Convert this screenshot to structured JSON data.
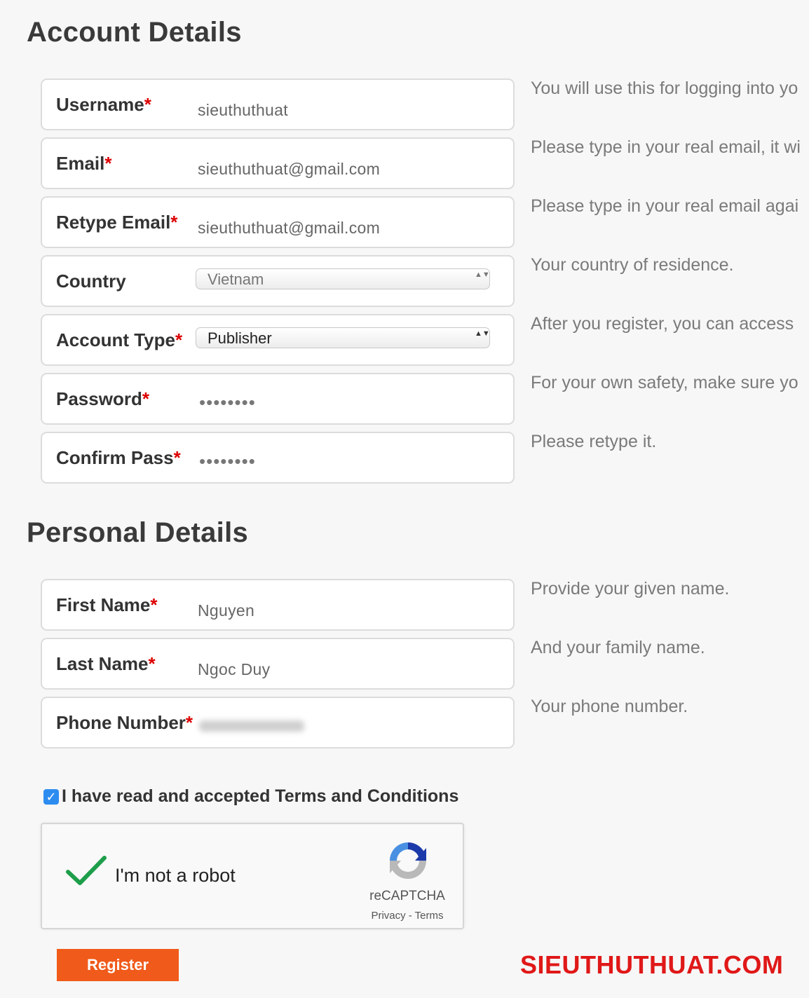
{
  "sections": {
    "account_title": "Account Details",
    "personal_title": "Personal Details"
  },
  "account_fields": [
    {
      "label": "Username",
      "required": "*",
      "value": "sieuthuthuat",
      "hint": "You will use this for logging into yo"
    },
    {
      "label": "Email",
      "required": "*",
      "value": "sieuthuthuat@gmail.com",
      "hint": "Please type in your real email, it wi"
    },
    {
      "label": "Retype Email",
      "required": "*",
      "value": "sieuthuthuat@gmail.com",
      "hint": "Please type in your real email agai"
    },
    {
      "label": "Country",
      "required": "",
      "value": "Vietnam",
      "hint": "Your country of residence."
    },
    {
      "label": "Account Type",
      "required": "*",
      "value": "Publisher",
      "hint": "After you register, you can access"
    },
    {
      "label": "Password",
      "required": "*",
      "value": "••••••••",
      "hint": "For your own safety, make sure yo"
    },
    {
      "label": "Confirm Pass",
      "required": "*",
      "value": "••••••••",
      "hint": "Please retype it."
    }
  ],
  "personal_fields": [
    {
      "label": "First Name",
      "required": "*",
      "value": "Nguyen",
      "hint": "Provide your given name."
    },
    {
      "label": "Last Name",
      "required": "*",
      "value": "Ngoc Duy",
      "hint": "And your family name."
    },
    {
      "label": "Phone Number",
      "required": "*",
      "value": "",
      "hint": "Your phone number."
    }
  ],
  "select_arrows": "▲▼",
  "terms": {
    "checked": true,
    "check_mark": "✓",
    "text": "I have read and accepted Terms and Conditions"
  },
  "captcha": {
    "text": "I'm not a robot",
    "brand": "reCAPTCHA",
    "links": "Privacy - Terms"
  },
  "register_label": "Register",
  "watermark": "SIEUTHUTHUAT.COM",
  "colors": {
    "required": "#dd0000",
    "register_bg": "#f05a1a",
    "watermark": "#e01818",
    "checkbox": "#2d8cf0",
    "captcha_check": "#1e9e4a"
  },
  "icons": [
    "checkmark-icon",
    "recaptcha-logo-icon",
    "select-arrows-icon"
  ]
}
